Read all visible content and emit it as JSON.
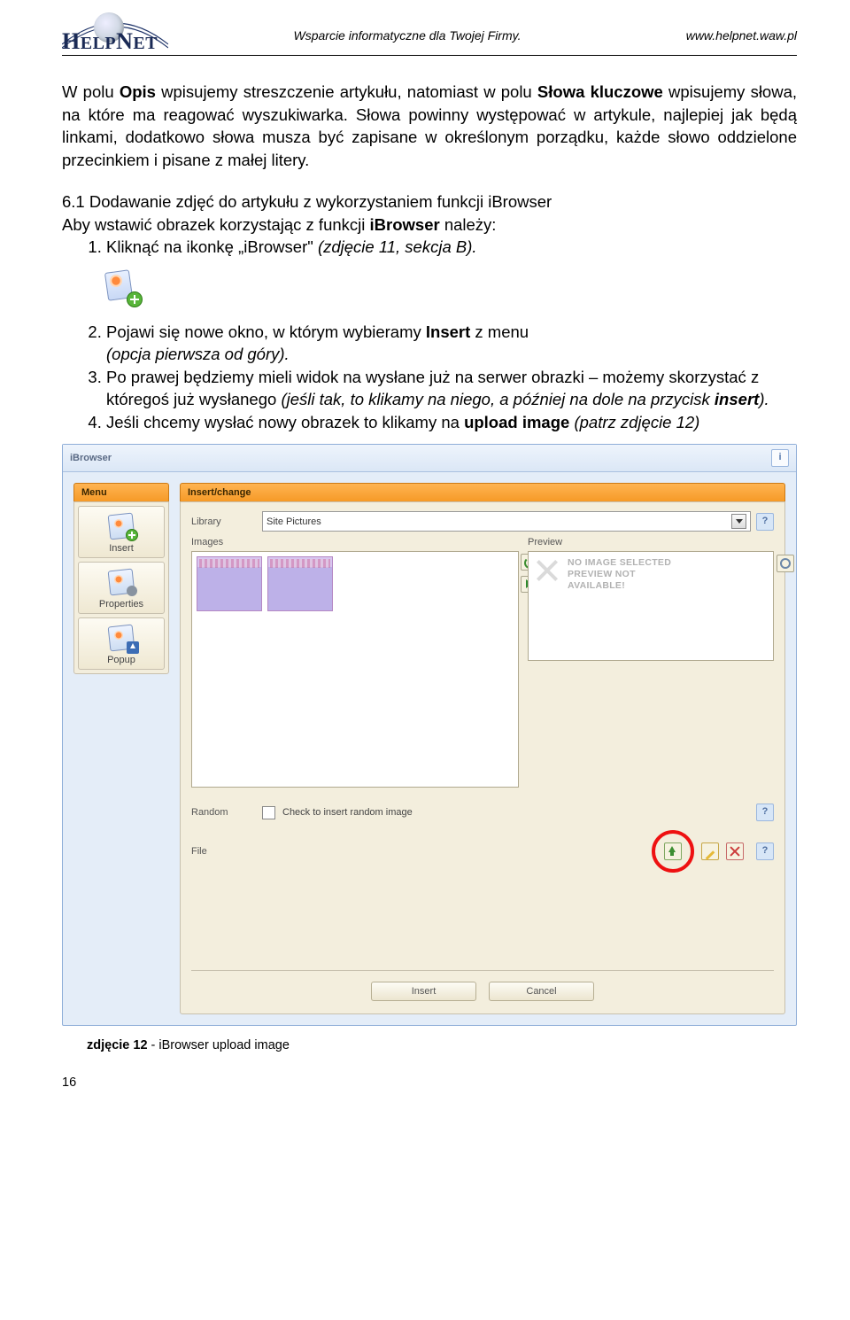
{
  "header": {
    "logo_text_pre": "H",
    "logo_text_mid": "ELP",
    "logo_text_n": "N",
    "logo_text_end": "ET",
    "tagline": "Wsparcie informatyczne dla Twojej Firmy.",
    "url": "www.helpnet.waw.pl"
  },
  "para1_pre": "W polu ",
  "para1_b1": "Opis",
  "para1_mid1": " wpisujemy streszczenie artykułu, natomiast w polu ",
  "para1_b2": "Słowa kluczowe",
  "para1_mid2": " wpisujemy słowa, na które ma reagować wyszukiwarka. Słowa powinny występować w artykule, najlepiej jak będą linkami, dodatkowo słowa musza być zapisane w określonym porządku, każde słowo oddzielone przecinkiem i pisane z małej litery.",
  "sect_num_title": "6.1 Dodawanie zdjęć do artykułu z wykorzystaniem funkcji iBrowser",
  "sect_intro_pre": "Aby wstawić obrazek korzystając z funkcji ",
  "sect_intro_b": "iBrowser",
  "sect_intro_post": " należy:",
  "step1_pre": "Kliknąć na ikonkę „iBrowser\" ",
  "step1_it": "(zdjęcie 11, sekcja B).",
  "step2_pre": "Pojawi się nowe okno, w którym wybieramy ",
  "step2_b": "Insert",
  "step2_mid": " z menu ",
  "step2_it": "(opcja pierwsza od góry).",
  "step3_pre": "Po prawej będziemy mieli widok na wysłane już na serwer obrazki – możemy skorzystać z któregoś już wysłanego ",
  "step3_it1": "(jeśli tak, to klikamy na niego, a później na dole na przycisk ",
  "step3_b": "insert",
  "step3_it2": ").",
  "step4_pre": "Jeśli chcemy wysłać nowy obrazek to klikamy na ",
  "step4_b": "upload image",
  "step4_it": " (patrz zdjęcie 12)",
  "ibrowser": {
    "title": "iBrowser",
    "menu_header": "Menu",
    "menu_items": [
      "Insert",
      "Properties",
      "Popup"
    ],
    "panel_header": "Insert/change",
    "labels": {
      "library": "Library",
      "images": "Images",
      "preview": "Preview",
      "random": "Random",
      "file": "File"
    },
    "library_selected": "Site Pictures",
    "preview_text_l1": "NO IMAGE SELECTED",
    "preview_text_l2": "PREVIEW NOT",
    "preview_text_l3": "AVAILABLE!",
    "random_text": "Check to insert random image",
    "buttons": {
      "insert": "Insert",
      "cancel": "Cancel"
    }
  },
  "caption_b": "zdjęcie 12",
  "caption_rest": " - iBrowser upload image",
  "page_number": "16"
}
